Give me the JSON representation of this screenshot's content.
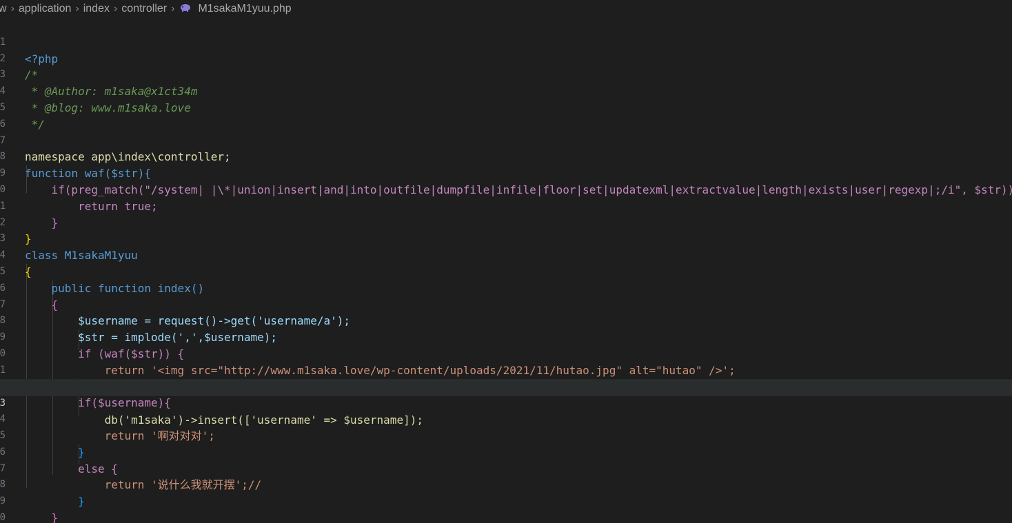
{
  "breadcrumb": {
    "items": [
      "w",
      "application",
      "index",
      "controller"
    ],
    "file": "M1sakaM1yuu.php",
    "file_icon": "php-elephant-icon"
  },
  "editor": {
    "active_line": 23,
    "line_numbers": [
      "1",
      "2",
      "3",
      "4",
      "5",
      "6",
      "7",
      "8",
      "9",
      "0",
      "1",
      "2",
      "3",
      "4",
      "5",
      "6",
      "7",
      "8",
      "9",
      "0",
      "1",
      "2",
      "3",
      "4",
      "5",
      "6",
      "7",
      "8",
      "9",
      "0"
    ],
    "lines": [
      "<?php",
      "/*",
      " * @Author: m1saka@x1ct34m",
      " * @blog: www.m1saka.love",
      " */",
      "",
      "namespace app\\index\\controller;",
      "function waf($str){",
      "    if(preg_match(\"/system| |\\*|union|insert|and|into|outfile|dumpfile|infile|floor|set|updatexml|extractvalue|length|exists|user|regexp|;/i\", $str)){",
      "        return true;",
      "    }",
      "}",
      "class M1sakaM1yuu",
      "{",
      "    public function index()",
      "    {",
      "        $username = request()->get('username/a');",
      "        $str = implode(',',$username);",
      "        if (waf($str)) {",
      "            return '<img src=\"http://www.m1saka.love/wp-content/uploads/2021/11/hutao.jpg\" alt=\"hutao\" />';",
      "        }",
      "        if($username){",
      "            db('m1saka')->insert(['username' => $username]);",
      "            return '啊对对对';",
      "        }",
      "        else {",
      "            return '说什么我就开摆';//",
      "        }",
      "    }",
      "}"
    ]
  },
  "colors": {
    "background": "#1e1e1e",
    "keyword": "#569cd6",
    "control": "#c586c0",
    "function": "#dcdcaa",
    "string": "#ce9178",
    "variable": "#9cdcfe",
    "class": "#4ec9b0",
    "comment": "#6a9955"
  }
}
